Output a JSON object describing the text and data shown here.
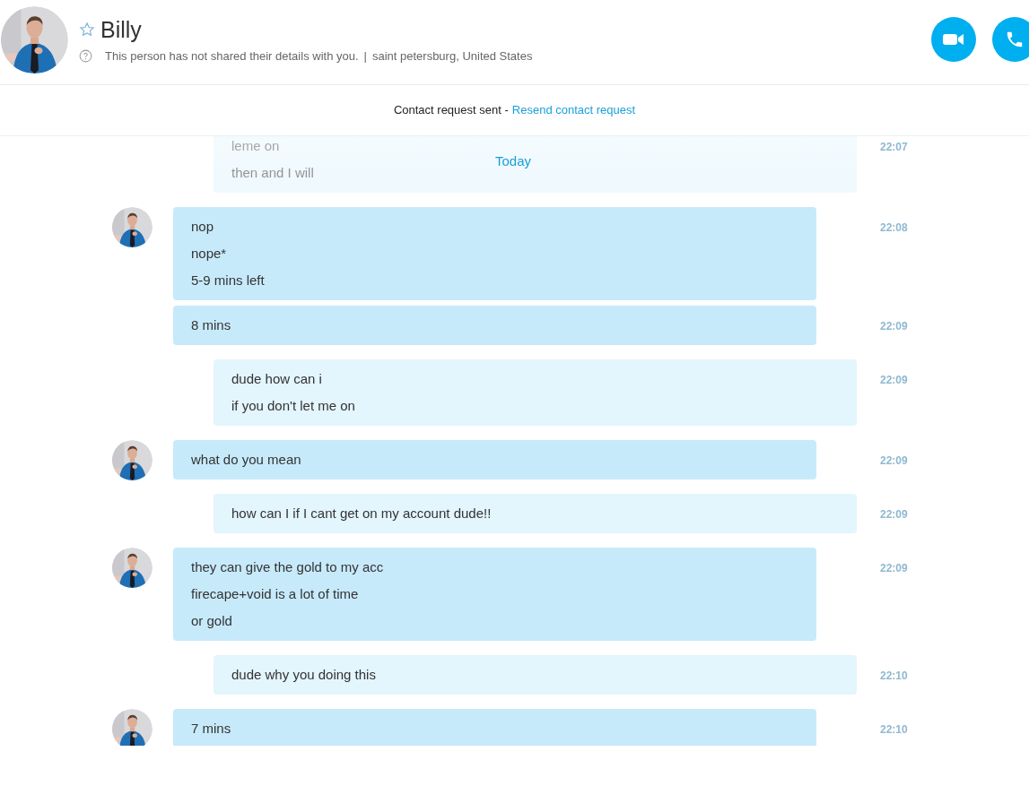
{
  "header": {
    "name": "Billy",
    "status_text": "This person has not shared their details with you.",
    "separator": "|",
    "location": "saint petersburg, United States"
  },
  "contact_bar": {
    "text": "Contact request sent -",
    "link": "Resend contact request"
  },
  "date_divider": "Today",
  "messages": [
    {
      "kind": "outgoing",
      "avatar": false,
      "lines": [
        "leme on",
        "then and I will"
      ],
      "time": "22:07"
    },
    {
      "kind": "incoming",
      "avatar": true,
      "lines": [
        "nop",
        "nope*",
        "5-9 mins left"
      ],
      "time": "22:08"
    },
    {
      "kind": "incoming",
      "avatar": false,
      "lines": [
        "8 mins"
      ],
      "time": "22:09"
    },
    {
      "kind": "outgoing",
      "avatar": false,
      "lines": [
        "dude how can i",
        "if you don't let me on"
      ],
      "time": "22:09"
    },
    {
      "kind": "incoming",
      "avatar": true,
      "lines": [
        "what do you mean"
      ],
      "time": "22:09"
    },
    {
      "kind": "outgoing",
      "avatar": false,
      "lines": [
        "how can I if I cant get on my account dude!!"
      ],
      "time": "22:09"
    },
    {
      "kind": "incoming",
      "avatar": true,
      "lines": [
        "they can give the gold to my acc",
        "firecape+void is a lot of time",
        "or gold"
      ],
      "time": "22:09"
    },
    {
      "kind": "outgoing",
      "avatar": false,
      "lines": [
        "dude why you doing this"
      ],
      "time": "22:10"
    },
    {
      "kind": "incoming",
      "avatar": true,
      "lines": [
        "7 mins"
      ],
      "time": "22:10"
    }
  ]
}
